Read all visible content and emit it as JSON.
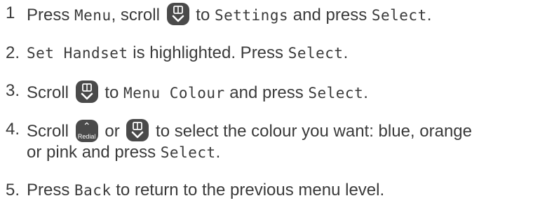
{
  "steps": [
    {
      "num": "1",
      "t1": "Press ",
      "k1": "Menu",
      "t2": ", scroll ",
      "t3": " to ",
      "k2": "Settings",
      "t4": " and press ",
      "k3": "Select",
      "t5": "."
    },
    {
      "num": "2.",
      "k1": "Set Handset",
      "t1": " is highlighted. Press ",
      "k2": "Select",
      "t2": "."
    },
    {
      "num": "3.",
      "t1": "Scroll ",
      "t2": " to ",
      "k1": "Menu Colour",
      "t3": " and press ",
      "k2": "Select",
      "t4": "."
    },
    {
      "num": "4.",
      "t1": "Scroll ",
      "redial_label": "Redial",
      "t2": " or ",
      "t3": " to select the colour you want: blue, orange",
      "t4": "or pink and press ",
      "k1": "Select",
      "t5": "."
    },
    {
      "num": "5.",
      "t1": "Press ",
      "k1": "Back",
      "t2": " to return to the previous menu level."
    }
  ],
  "icons": {
    "phonebook_down": "phonebook-down-key-icon",
    "redial_up": "redial-up-key-icon"
  },
  "colors": {
    "text": "#3a3a3a",
    "key_bg": "#4a4a4a",
    "key_fg": "#ffffff"
  }
}
